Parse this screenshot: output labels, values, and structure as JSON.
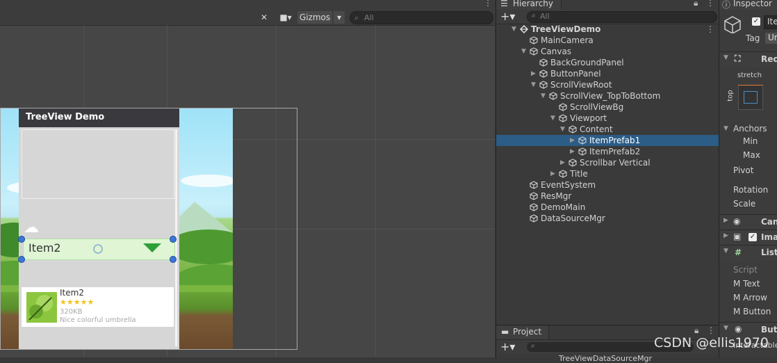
{
  "scene": {
    "gizmos_label": "Gizmos",
    "search_placeholder": "All"
  },
  "game": {
    "panel_title": "TreeView Demo",
    "selected_item_label": "Item2",
    "card": {
      "name": "Item2",
      "stars": "★★★★★",
      "size": "320KB",
      "desc": "Nice colorful umbrella"
    }
  },
  "hierarchy": {
    "tab_label": "Hierarchy",
    "search_placeholder": "All",
    "items": [
      {
        "label": "TreeViewDemo"
      },
      {
        "label": "MainCamera"
      },
      {
        "label": "Canvas"
      },
      {
        "label": "BackGroundPanel"
      },
      {
        "label": "ButtonPanel"
      },
      {
        "label": "ScrollViewRoot"
      },
      {
        "label": "ScrollView_TopToBottom"
      },
      {
        "label": "ScrollViewBg"
      },
      {
        "label": "Viewport"
      },
      {
        "label": "Content"
      },
      {
        "label": "ItemPrefab1"
      },
      {
        "label": "ItemPrefab2"
      },
      {
        "label": "Scrollbar Vertical"
      },
      {
        "label": "Title"
      },
      {
        "label": "EventSystem"
      },
      {
        "label": "ResMgr"
      },
      {
        "label": "DemoMain"
      },
      {
        "label": "DataSourceMgr"
      }
    ]
  },
  "project": {
    "tab_label": "Project",
    "partial_item": "TreeViewDataSourceMgr"
  },
  "inspector": {
    "tab_label": "Inspector",
    "name_partial": "Ite",
    "tag_label": "Tag",
    "tag_value_partial": "Ur",
    "rect_partial": "Rec",
    "stretch_label": "stretch",
    "top_label": "top",
    "anchors_label": "Anchors",
    "min_label": "Min",
    "max_label": "Max",
    "pivot_label": "Pivot",
    "rotation_label": "Rotation",
    "scale_label": "Scale",
    "canvas_partial": "Can",
    "image_partial": "Imag",
    "list_partial": "List",
    "script_label": "Script",
    "m_text_label": "M Text",
    "m_arrow_label": "M Arrow",
    "m_button_label": "M Button",
    "button_partial": "Butt",
    "interactable_partial": "Interactable"
  },
  "watermark": "CSDN @ellis1970",
  "colors": {
    "selection": "#2c5d87",
    "editor_bg": "#383838",
    "item_bar": "#dff5d4",
    "arrow_green": "#2e9e3a"
  }
}
